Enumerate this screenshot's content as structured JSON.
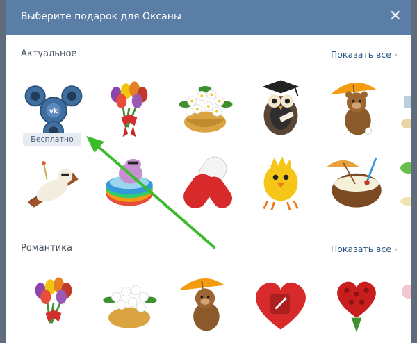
{
  "header": {
    "title": "Выберите подарок для Оксаны",
    "close_icon": "close-icon"
  },
  "sections": [
    {
      "title": "Актуальное",
      "show_all": "Показать все"
    },
    {
      "title": "Романтика",
      "show_all": "Показать все"
    }
  ],
  "badge": {
    "free": "Бесплатно"
  },
  "stickers": {
    "actual": [
      "vk-fidget-spinner",
      "tulip-bouquet",
      "flower-basket",
      "graduate-owl",
      "bear-with-umbrella",
      "cut-off-gift",
      "sunbathing-bear",
      "hippo-in-pool",
      "red-white-pill",
      "yellow-chick",
      "coconut-cocktail",
      "cut-off-palm"
    ],
    "romance": [
      "tulip-bouquet",
      "flower-basket",
      "bear-with-umbrella",
      "heart-with-wand",
      "rose-heart-bouquet",
      "cut-off-flower"
    ]
  },
  "colors": {
    "header": "#5b7ea6",
    "link": "#2a5885",
    "arrow": "#3dbb2f"
  }
}
